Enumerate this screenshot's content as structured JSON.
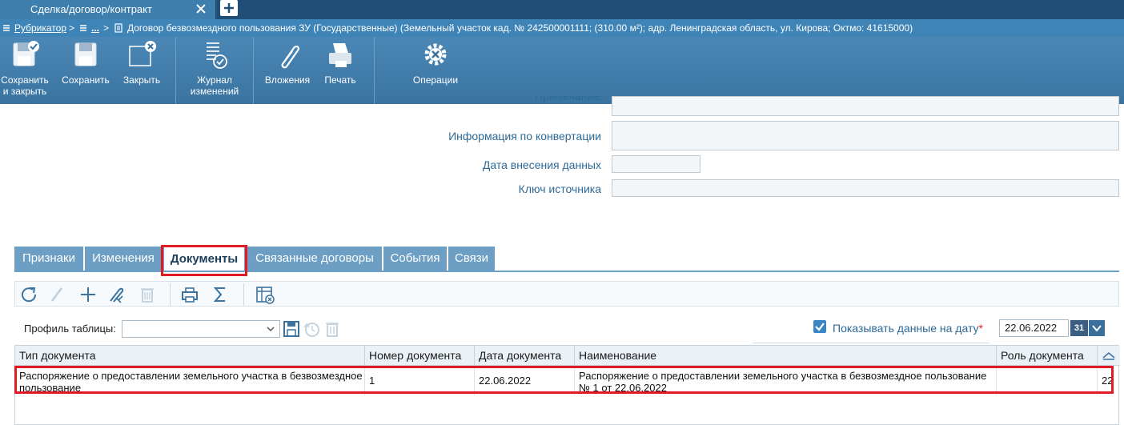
{
  "tabstrip": {
    "tab_label": "Сделка/договор/контракт",
    "close_icon": "close-icon",
    "new_tab_icon": "plus-icon"
  },
  "breadcrumb": {
    "root": "Рубрикатор",
    "sep1": ">",
    "middle": "...",
    "sep2": ">",
    "current": "Договор безвозмездного пользования ЗУ (Государственные) (Земельный участок кад. № 242500001111; (310.00 м²); адр. Ленинградская область, ул. Кирова; Октмо: 41615000)"
  },
  "toolbar": {
    "buttons": [
      {
        "label": "Сохранить\nи закрыть",
        "icon": "save-close-icon"
      },
      {
        "label": "Сохранить",
        "icon": "save-icon"
      },
      {
        "label": "Закрыть",
        "icon": "close-window-icon"
      },
      {
        "label": "Журнал\nизменений",
        "icon": "journal-icon"
      },
      {
        "label": "Вложения",
        "icon": "paperclip-icon"
      },
      {
        "label": "Печать",
        "icon": "printer-icon"
      },
      {
        "label": "Операции",
        "icon": "gear-icon"
      }
    ]
  },
  "form": {
    "partial_label": "Примечание",
    "conversion_label": "Информация по конвертации",
    "conversion_value": "",
    "entry_date_label": "Дата внесения данных",
    "entry_date_value": "",
    "source_key_label": "Ключ источника",
    "source_key_value": ""
  },
  "tabs": [
    {
      "label": "Признаки",
      "active": false
    },
    {
      "label": "Изменения",
      "active": false
    },
    {
      "label": "Документы",
      "active": true
    },
    {
      "label": "Связанные договоры",
      "active": false
    },
    {
      "label": "События",
      "active": false
    },
    {
      "label": "Связи",
      "active": false
    }
  ],
  "grid_toolbar": {
    "icons": [
      "refresh-icon",
      "edit-icon",
      "add-icon",
      "attach-icon",
      "delete-icon",
      "print-icon",
      "sum-icon",
      "table-settings-icon"
    ]
  },
  "profile": {
    "label": "Профиль таблицы:",
    "value": "",
    "save_icon": "save-profile-icon",
    "reset_icon": "reset-profile-icon",
    "delete_icon": "delete-profile-icon"
  },
  "show_date": {
    "label": "Показывать данные на дату",
    "required_mark": "*",
    "checked": true,
    "date": "22.06.2022",
    "calendar_label": "31"
  },
  "grid": {
    "columns": [
      "Тип документа",
      "Номер документа",
      "Дата документа",
      "Наименование",
      "Роль документа"
    ],
    "rows": [
      {
        "type": "Распоряжение о предоставлении земельного участка в безвозмездное пользование",
        "number": "1",
        "date": "22.06.2022",
        "name": "Распоряжение о предоставлении земельного участка в безвозмездное пользование № 1 от 22.06.2022",
        "role": "",
        "extra": "22"
      }
    ]
  },
  "colors": {
    "header_dark": "#1f4f76",
    "toolbar": "#3f84b7",
    "tab": "#6d9ec4",
    "highlight": "#e01b24",
    "label": "#2d6a98"
  }
}
